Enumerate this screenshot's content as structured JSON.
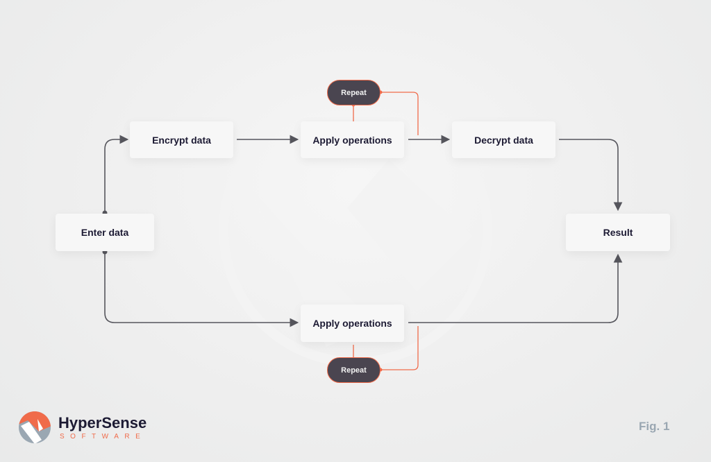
{
  "nodes": {
    "enter": "Enter data",
    "encrypt": "Encrypt data",
    "apply_top": "Apply operations",
    "decrypt": "Decrypt data",
    "result": "Result",
    "apply_bottom": "Apply operations",
    "repeat_top": "Repeat",
    "repeat_bottom": "Repeat"
  },
  "brand": {
    "name": "HyperSense",
    "sub": "SOFTWARE"
  },
  "figure_label": "Fig. 1",
  "colors": {
    "arrow": "#55555c",
    "loop": "#f06b4a",
    "pill": "#4a4550",
    "text": "#1c1a33"
  }
}
